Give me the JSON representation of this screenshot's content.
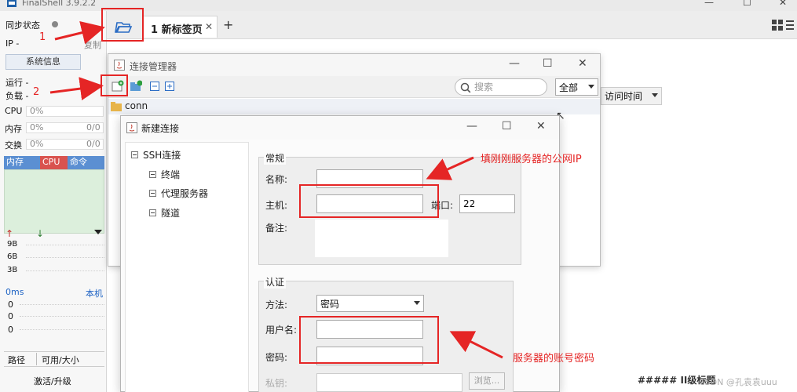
{
  "window": {
    "title": "FinalShell 3.9.2.2"
  },
  "left_panel": {
    "sync_status": "同步状态",
    "ip_label": "IP -",
    "copy": "复制",
    "sysinfo_button": "系统信息",
    "running": "运行 -",
    "load": "负载 -",
    "cpu_label": "CPU",
    "cpu_value": "0%",
    "mem_label": "内存",
    "mem_value": "0%",
    "mem_ratio": "0/0",
    "swap_label": "交换",
    "swap_value": "0%",
    "swap_ratio": "0/0",
    "tabs": [
      "内存",
      "CPU",
      "命令"
    ],
    "net_scale": [
      "9B",
      "6B",
      "3B"
    ],
    "latency": "0ms",
    "local": "本机",
    "ping_values": [
      "0",
      "0",
      "0"
    ],
    "path_col": "路径",
    "avail_col": "可用/大小",
    "upgrade": "激活/升级"
  },
  "tabs": {
    "new_tab_label": "1 新标签页",
    "plus": "+"
  },
  "connection_manager": {
    "title": "连接管理器",
    "search_placeholder": "搜索",
    "filter_value": "全部",
    "sort_value": "访问时间",
    "folder_name": "conn"
  },
  "new_connection": {
    "title": "新建连接",
    "tree": {
      "root": "SSH连接",
      "children": [
        "终端",
        "代理服务器",
        "隧道"
      ]
    },
    "general_group": "常规",
    "name_label": "名称:",
    "host_label": "主机:",
    "port_label": "端口:",
    "port_value": "22",
    "note_label": "备注:",
    "auth_group": "认证",
    "method_label": "方法:",
    "method_value": "密码",
    "username_label": "用户名:",
    "password_label": "密码:",
    "private_key_label": "私钥:",
    "browse_button": "浏览..."
  },
  "annotations": {
    "step1": "1",
    "step2": "2",
    "host_hint": "填刚刚服务器的公网IP",
    "account_hint": "服务器的账号密码"
  },
  "watermark": "CSDN @孔袁袁uuu",
  "side_fragment": "##### II级标题",
  "colors": {
    "annotation_red": "#e52525",
    "tab_blue": "#5b8fd2",
    "cpu_tab_red": "#d9534f"
  }
}
